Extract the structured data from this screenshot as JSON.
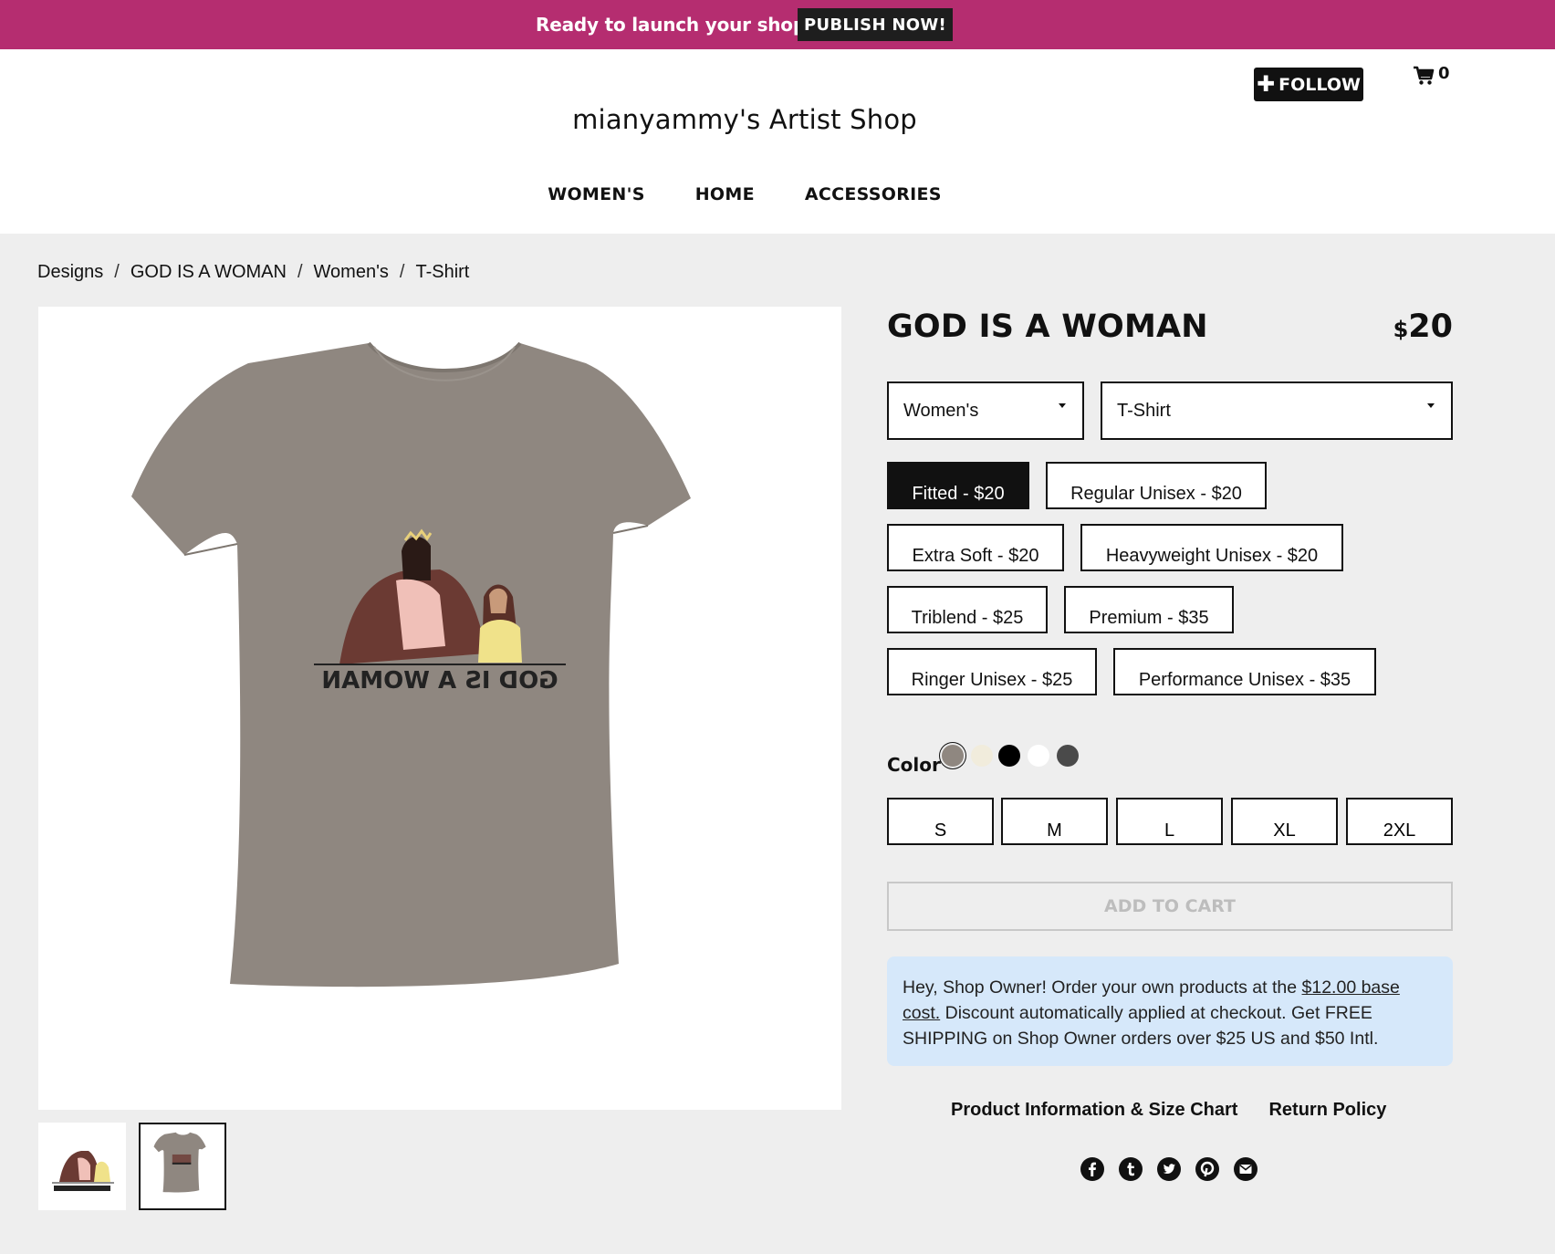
{
  "promo": {
    "text": "Ready to launch your shop?",
    "button": "PUBLISH NOW!"
  },
  "header": {
    "shop_title": "mianyammy's Artist Shop",
    "follow_label": "FOLLOW",
    "cart_count": "0",
    "nav": [
      "WOMEN'S",
      "HOME",
      "ACCESSORIES"
    ]
  },
  "breadcrumb": [
    "Designs",
    "GOD IS A WOMAN",
    "Women's",
    "T-Shirt"
  ],
  "product": {
    "title": "GOD IS A WOMAN",
    "currency": "$",
    "price": "20",
    "design_text": "GOD IS A WOMAN",
    "shirt_color": "#8f8780",
    "gender_select": "Women's",
    "type_select": "T-Shirt",
    "styles": [
      {
        "label": "Fitted - $20",
        "selected": true
      },
      {
        "label": "Regular Unisex - $20",
        "selected": false
      },
      {
        "label": "Extra Soft - $20",
        "selected": false
      },
      {
        "label": "Heavyweight Unisex - $20",
        "selected": false
      },
      {
        "label": "Triblend - $25",
        "selected": false
      },
      {
        "label": "Premium - $35",
        "selected": false
      },
      {
        "label": "Ringer Unisex - $25",
        "selected": false
      },
      {
        "label": "Performance Unisex - $35",
        "selected": false
      }
    ],
    "color_label": "Color",
    "colors": [
      "#8f8780",
      "#f1ecdc",
      "#000000",
      "#ffffff",
      "#4a4a4a"
    ],
    "sizes": [
      "S",
      "M",
      "L",
      "XL",
      "2XL"
    ],
    "add_to_cart": "ADD TO CART"
  },
  "owner_note": {
    "before": "Hey, Shop Owner! Order your own products at the ",
    "link": "$12.00 base cost.",
    "after": " Discount automatically applied at checkout. Get FREE SHIPPING on Shop Owner orders over $25 US and $50 Intl."
  },
  "info_links": [
    "Product Information & Size Chart",
    "Return Policy"
  ],
  "social": [
    "facebook-icon",
    "tumblr-icon",
    "twitter-icon",
    "pinterest-icon",
    "email-icon"
  ],
  "colors": {
    "brand": "#b52d70",
    "note_bg": "#d6e8fa"
  }
}
